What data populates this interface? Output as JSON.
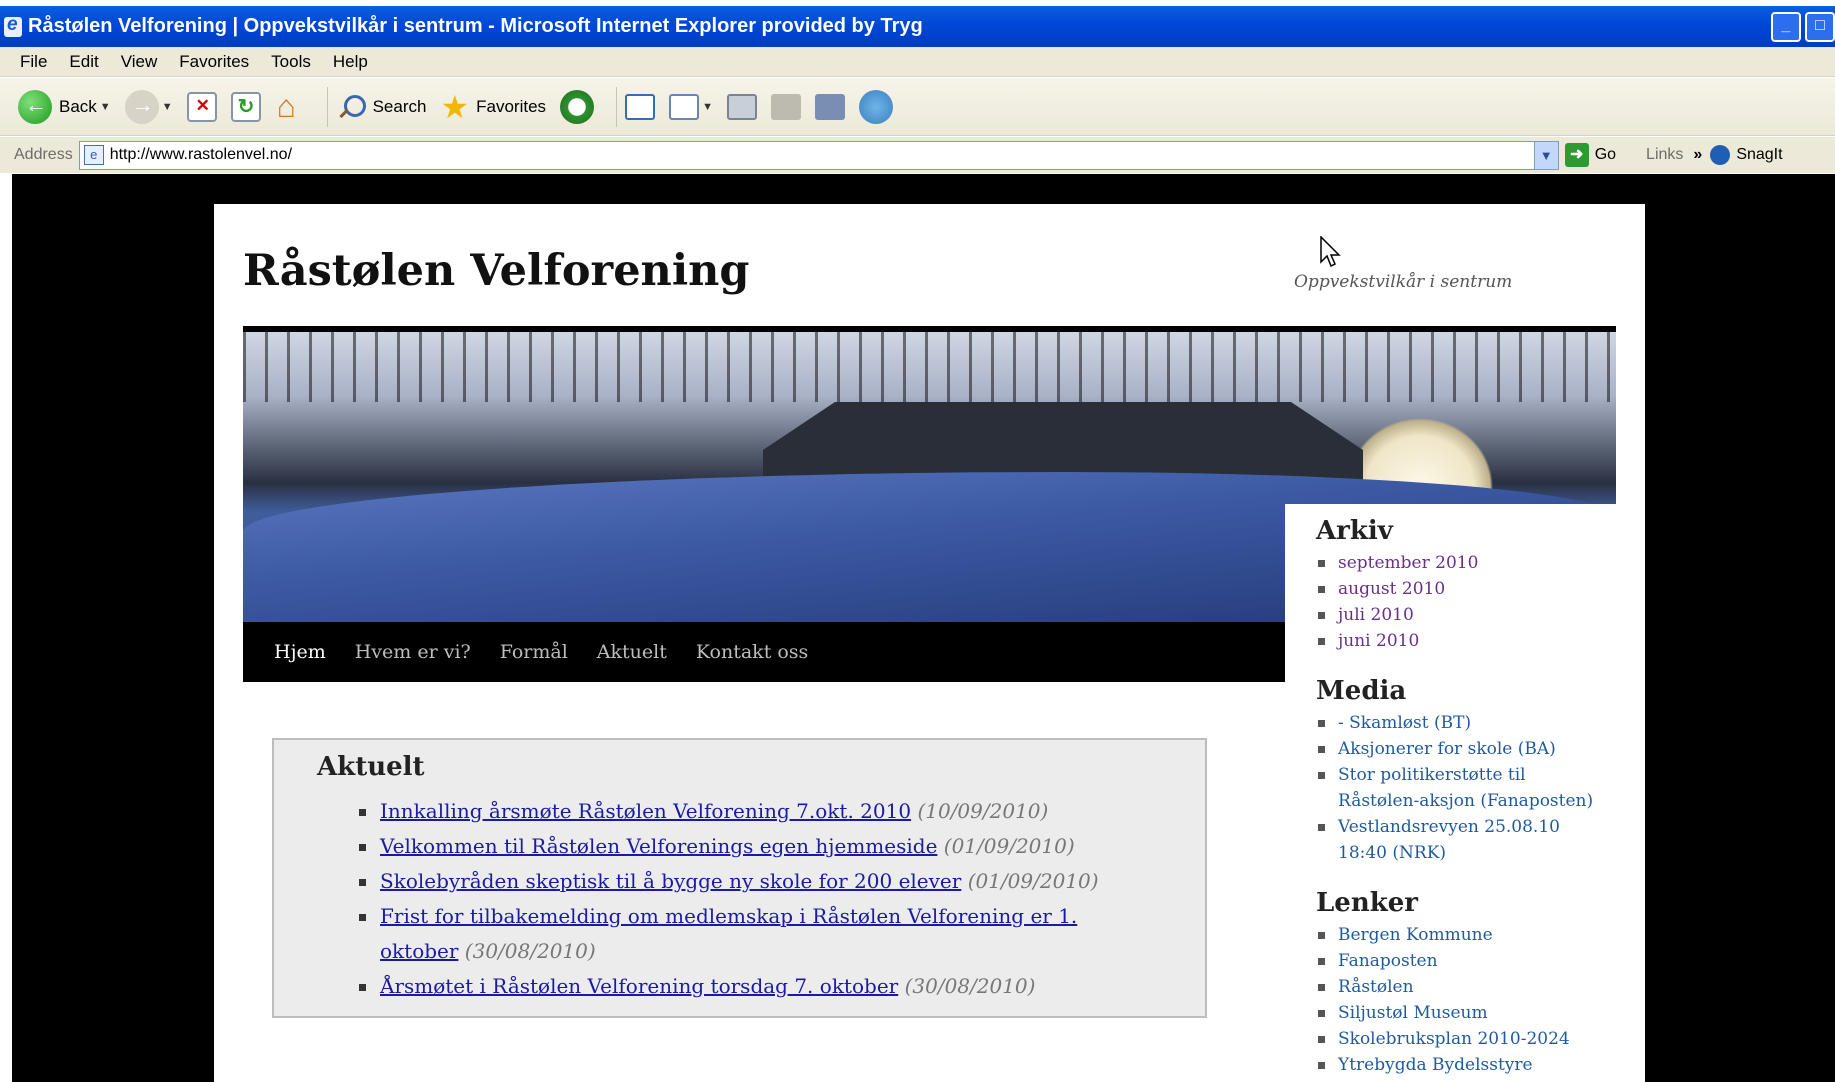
{
  "window": {
    "title": "Råstølen Velforening | Oppvekstvilkår i sentrum - Microsoft Internet Explorer provided by Tryg",
    "minimize_icon": "minimize-icon",
    "maximize_icon": "restore-icon"
  },
  "menu": [
    "File",
    "Edit",
    "View",
    "Favorites",
    "Tools",
    "Help"
  ],
  "toolbar": {
    "back": "Back",
    "search": "Search",
    "favorites": "Favorites"
  },
  "address": {
    "label": "Address",
    "url": "http://www.rastolenvel.no/",
    "go": "Go",
    "links": "Links",
    "snagit": "SnagIt"
  },
  "site": {
    "title": "Råstølen Velforening",
    "tagline": "Oppvekstvilkår i sentrum"
  },
  "nav": [
    {
      "label": "Hjem",
      "active": true
    },
    {
      "label": "Hvem er vi?",
      "active": false
    },
    {
      "label": "Formål",
      "active": false
    },
    {
      "label": "Aktuelt",
      "active": false
    },
    {
      "label": "Kontakt oss",
      "active": false
    }
  ],
  "aktuelt": {
    "heading": "Aktuelt",
    "items": [
      {
        "title": "Innkalling årsmøte Råstølen Velforening 7.okt. 2010",
        "date": "(10/09/2010)"
      },
      {
        "title": "Velkommen til Råstølen Velforenings egen hjemmeside",
        "date": "(01/09/2010)"
      },
      {
        "title": "Skolebyråden skeptisk til å bygge ny skole for 200 elever",
        "date": "(01/09/2010)"
      },
      {
        "title": "Frist for tilbakemelding om medlemskap i Råstølen Velforening er 1. oktober",
        "date": "(30/08/2010)"
      },
      {
        "title": "Årsmøtet i Råstølen Velforening torsdag 7. oktober",
        "date": "(30/08/2010)"
      }
    ]
  },
  "sidebar": {
    "arkiv": {
      "heading": "Arkiv",
      "items": [
        "september 2010",
        "august 2010",
        "juli 2010",
        "juni 2010"
      ]
    },
    "media": {
      "heading": "Media",
      "items": [
        "- Skamløst (BT)",
        "Aksjonerer for skole (BA)",
        "Stor politikerstøtte til Råstølen-aksjon (Fanaposten)",
        "Vestlandsrevyen 25.08.10 18:40 (NRK)"
      ]
    },
    "lenker": {
      "heading": "Lenker",
      "items": [
        "Bergen Kommune",
        "Fanaposten",
        "Råstølen",
        "Siljustøl Museum",
        "Skolebruksplan 2010-2024",
        "Ytrebygda Bydelsstyre"
      ]
    }
  },
  "colors": {
    "titlebar": "#0047d6",
    "chrome": "#ece9d8",
    "link": "#1a1aa6",
    "visited_link": "#6a2f8a",
    "sidebar_link": "#1f5a9f"
  }
}
